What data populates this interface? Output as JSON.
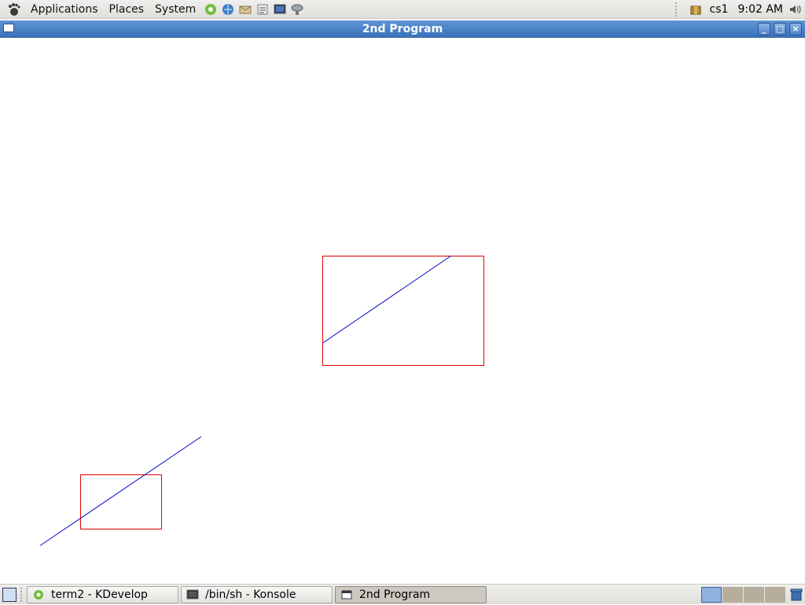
{
  "top_panel": {
    "menus": [
      "Applications",
      "Places",
      "System"
    ],
    "launchers": [
      "kdevelop-icon",
      "web-browser-icon",
      "mail-icon",
      "text-editor-icon",
      "terminal-icon",
      "network-icon"
    ],
    "user": "cs1",
    "clock": "9:02 AM"
  },
  "window": {
    "title": "2nd Program"
  },
  "taskbar": {
    "tasks": [
      {
        "label": "term2 - KDevelop",
        "icon": "kdevelop-icon",
        "active": false
      },
      {
        "label": "/bin/sh - Konsole",
        "icon": "konsole-icon",
        "active": false
      },
      {
        "label": "2nd Program",
        "icon": "window-icon",
        "active": true
      }
    ],
    "workspaces": 4,
    "current_workspace": 1
  },
  "colors": {
    "rect_stroke": "#e00000",
    "line_stroke": "#0000cc",
    "titlebar": "#4a84c8",
    "panel": "#e8e7e3"
  }
}
